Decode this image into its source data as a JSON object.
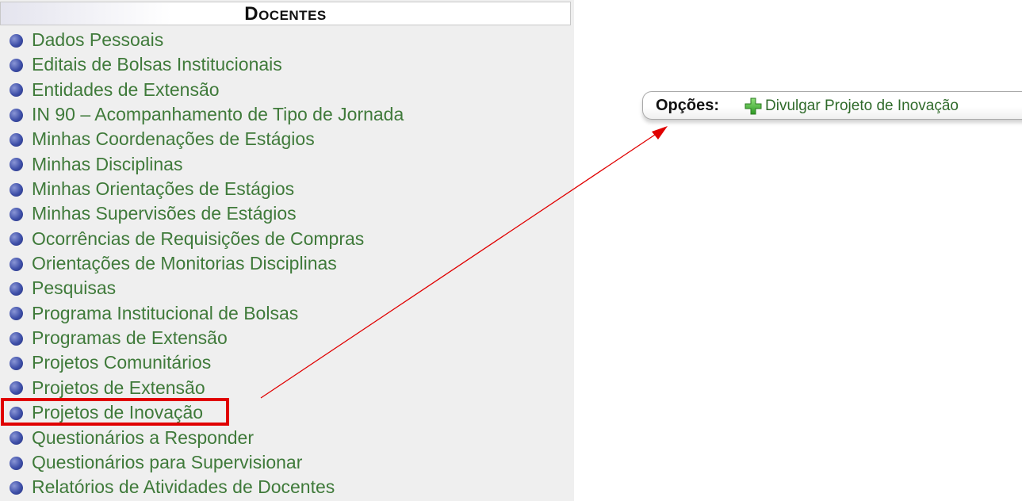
{
  "panel": {
    "title": "Docentes",
    "items": [
      {
        "label": "Dados Pessoais"
      },
      {
        "label": "Editais de Bolsas Institucionais"
      },
      {
        "label": "Entidades de Extensão"
      },
      {
        "label": "IN 90 – Acompanhamento de Tipo de Jornada"
      },
      {
        "label": "Minhas Coordenações de Estágios"
      },
      {
        "label": "Minhas Disciplinas"
      },
      {
        "label": "Minhas Orientações de Estágios"
      },
      {
        "label": "Minhas Supervisões de Estágios"
      },
      {
        "label": "Ocorrências de Requisições de Compras"
      },
      {
        "label": "Orientações de Monitorias Disciplinas"
      },
      {
        "label": "Pesquisas"
      },
      {
        "label": "Programa Institucional de Bolsas"
      },
      {
        "label": "Programas de Extensão"
      },
      {
        "label": "Projetos Comunitários"
      },
      {
        "label": "Projetos de Extensão"
      },
      {
        "label": "Projetos de Inovação"
      },
      {
        "label": "Questionários a Responder"
      },
      {
        "label": "Questionários para Supervisionar"
      },
      {
        "label": "Relatórios de Atividades de Docentes"
      }
    ]
  },
  "options": {
    "label": "Opções:",
    "icon": "plus-icon",
    "link_label": "Divulgar Projeto de Inovação"
  },
  "annotation": {
    "highlight_color": "#e00000",
    "arrow_color": "#e00000"
  },
  "colors": {
    "link_green": "#3f7a3a",
    "bullet_blue": "#3e4fa8"
  }
}
